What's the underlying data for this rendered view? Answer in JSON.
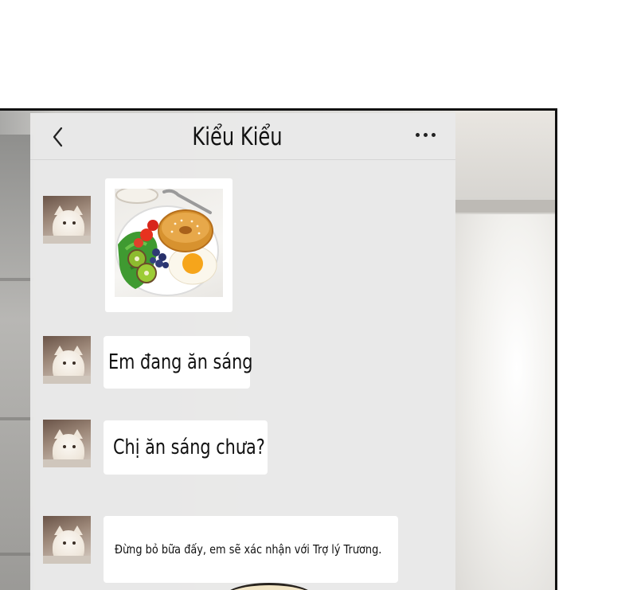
{
  "chat": {
    "title": "Kiểu Kiểu",
    "back_icon": "chevron-left-icon",
    "more_icon": "more-horizontal-icon"
  },
  "messages": [
    {
      "type": "image",
      "image": "breakfast-plate: bagel, salad, egg, kiwi, blueberries"
    },
    {
      "type": "text",
      "text": "Em đang ăn sáng"
    },
    {
      "type": "text",
      "text": "Chị ăn sáng chưa?"
    },
    {
      "type": "text",
      "text": "Đừng bỏ bữa đấy, em sẽ xác nhận với Trợ lý Trương."
    }
  ],
  "colors": {
    "chat_background": "#e9e9e9",
    "bubble": "#ffffff",
    "frame_border": "#111111",
    "text": "#111111"
  }
}
